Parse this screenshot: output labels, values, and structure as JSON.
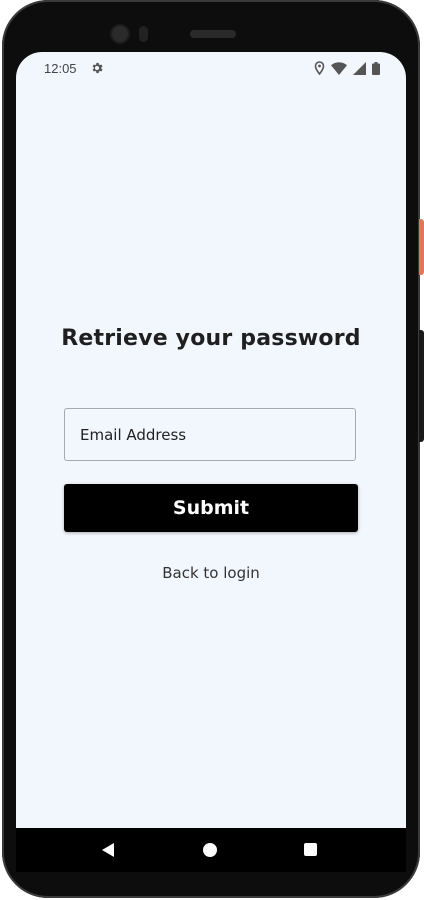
{
  "status_bar": {
    "time": "12:05",
    "icons": [
      "settings-icon",
      "location-icon",
      "wifi-icon",
      "signal-icon",
      "battery-icon"
    ]
  },
  "screen": {
    "title": "Retrieve your password",
    "email_placeholder": "Email Address",
    "email_value": "",
    "submit_label": "Submit",
    "back_link_label": "Back to login"
  },
  "nav_bar": {
    "icons": [
      "back-icon",
      "home-icon",
      "recents-icon"
    ]
  },
  "colors": {
    "screen_background": "#f2f6fd",
    "button_background": "#000000",
    "button_text": "#ffffff",
    "phone_frame": "#0d0d0d",
    "side_button_accent": "#e2765a"
  }
}
